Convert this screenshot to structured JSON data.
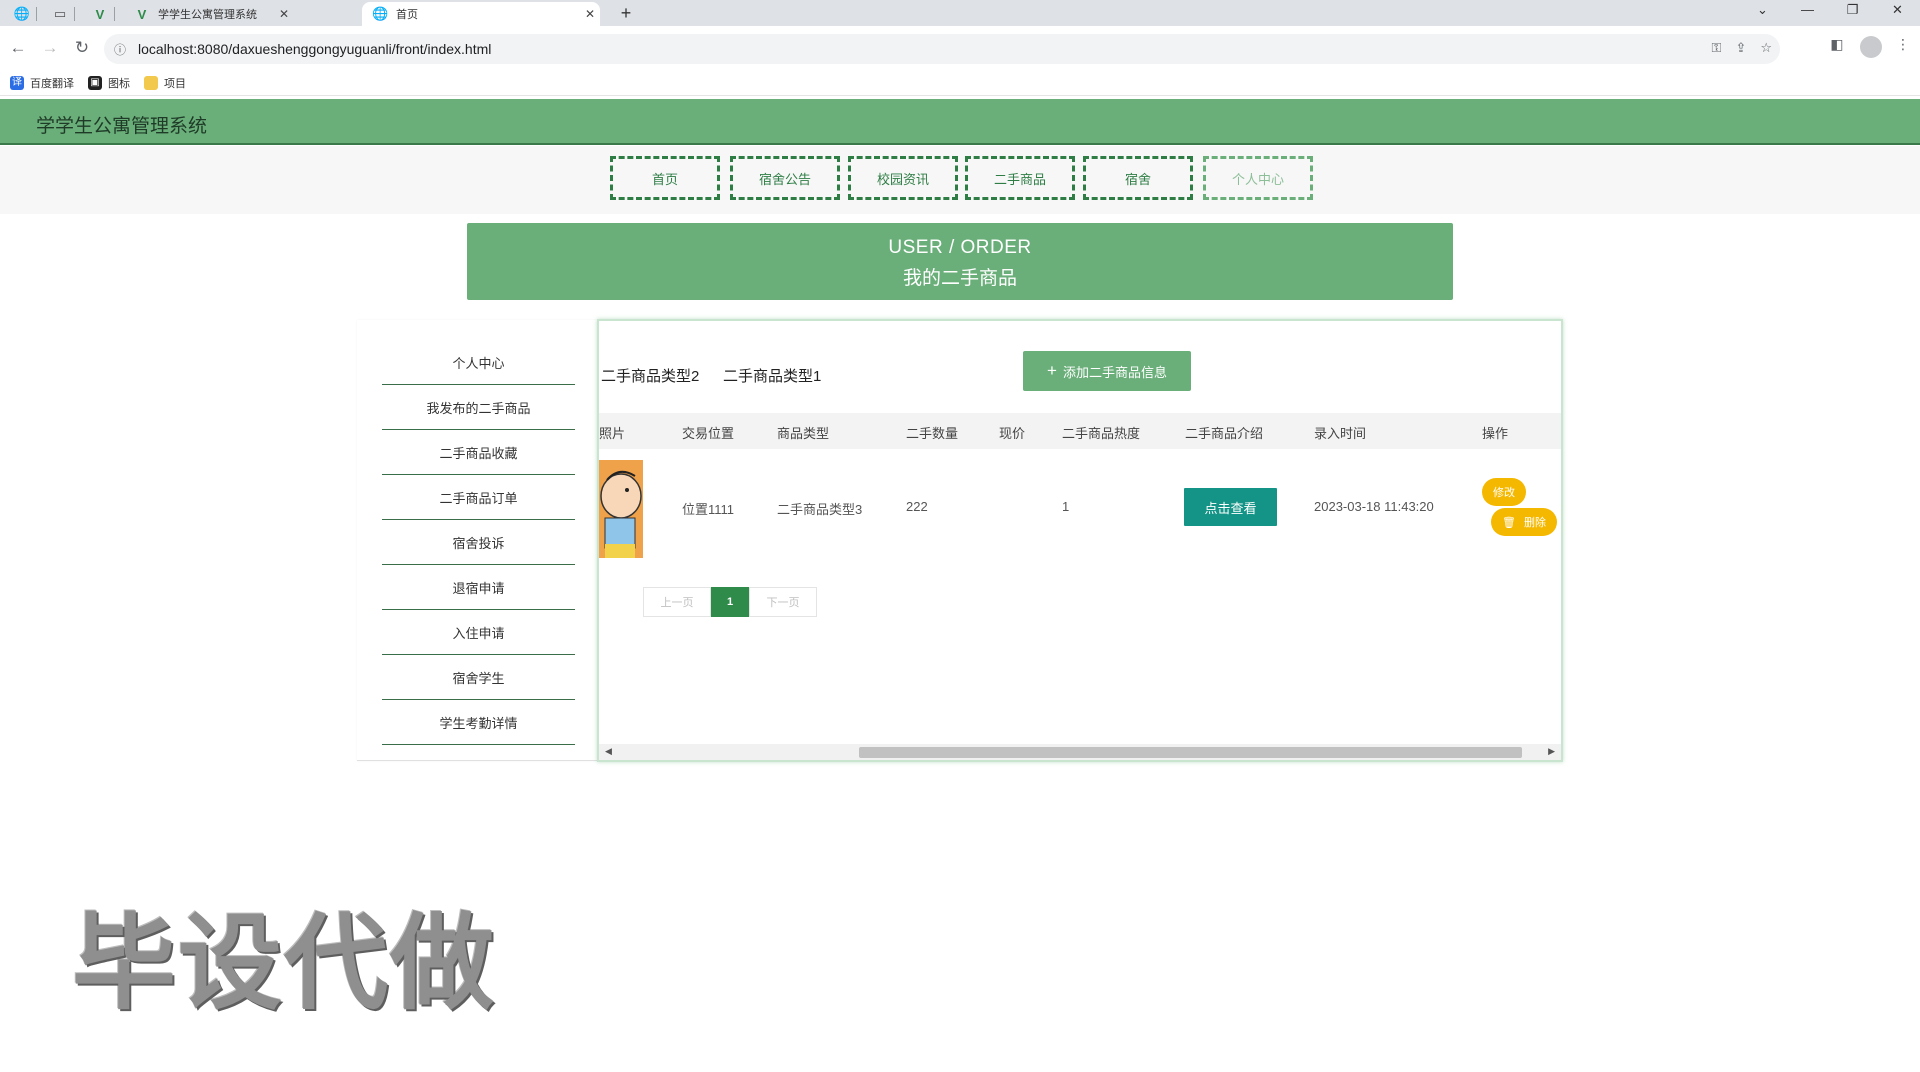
{
  "browser": {
    "tabs": [
      {
        "title": "学学生公寓管理系统",
        "active": false
      },
      {
        "title": "首页",
        "active": true
      }
    ],
    "url": "localhost:8080/daxueshenggongyuguanli/front/index.html",
    "bookmarks": [
      "百度翻译",
      "图标",
      "项目"
    ]
  },
  "site": {
    "title": "学学生公寓管理系统",
    "nav": [
      "首页",
      "宿舍公告",
      "校园资讯",
      "二手商品",
      "宿舍",
      "个人中心"
    ]
  },
  "banner": {
    "en": "USER / ORDER",
    "cn": "我的二手商品"
  },
  "sidebar": {
    "items": [
      "个人中心",
      "我发布的二手商品",
      "二手商品收藏",
      "二手商品订单",
      "宿舍投诉",
      "退宿申请",
      "入住申请",
      "宿舍学生",
      "学生考勤详情"
    ]
  },
  "main": {
    "type_filters": [
      "二手商品类型2",
      "二手商品类型1"
    ],
    "add_button": "添加二手商品信息",
    "columns": [
      "照片",
      "交易位置",
      "商品类型",
      "二手数量",
      "现价",
      "二手商品热度",
      "二手商品介绍",
      "录入时间",
      "操作"
    ],
    "rows": [
      {
        "location": "位置1111",
        "type": "二手商品类型3",
        "quantity": "222",
        "price": "",
        "heat": "1",
        "intro_button": "点击查看",
        "created": "2023-03-18 11:43:20",
        "edit_label": "修改",
        "delete_label": "删除"
      }
    ],
    "pager": {
      "prev": "上一页",
      "current": "1",
      "next": "下一页"
    }
  },
  "watermark": "毕设代做",
  "colors": {
    "header_green": "#6aaf7a",
    "nav_green": "#2e7d45",
    "teal_button": "#139487",
    "action_yellow": "#f5b800"
  }
}
